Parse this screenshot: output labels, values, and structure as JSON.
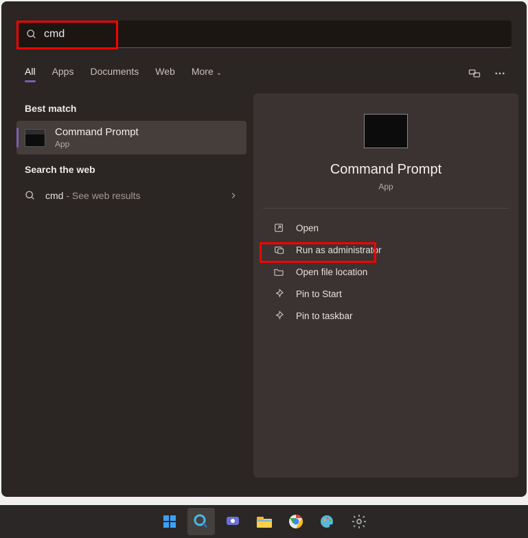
{
  "search": {
    "value": "cmd"
  },
  "tabs": {
    "all": "All",
    "apps": "Apps",
    "documents": "Documents",
    "web": "Web",
    "more": "More"
  },
  "left": {
    "best_match_label": "Best match",
    "best_match": {
      "title": "Command Prompt",
      "sub": "App"
    },
    "web_label": "Search the web",
    "web_item": {
      "query": "cmd",
      "suffix": " - See web results"
    }
  },
  "detail": {
    "title": "Command Prompt",
    "sub": "App",
    "actions": {
      "open": "Open",
      "runadmin": "Run as administrator",
      "openloc": "Open file location",
      "pinstart": "Pin to Start",
      "pintaskbar": "Pin to taskbar"
    }
  }
}
